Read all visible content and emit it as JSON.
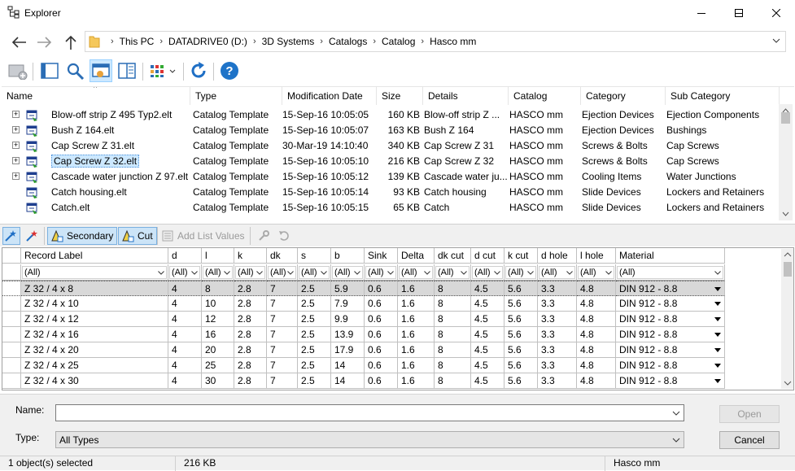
{
  "window": {
    "title": "Explorer",
    "controls": {
      "minimize": "minimize-icon",
      "maximize": "maximize-icon",
      "close": "close-icon"
    }
  },
  "address": {
    "crumbs": [
      "This PC",
      "DATADRIVE0 (D:)",
      "3D Systems",
      "Catalogs",
      "Catalog",
      "Hasco mm"
    ]
  },
  "filelist": {
    "columns": [
      "Name",
      "Type",
      "Modification Date",
      "Size",
      "Details",
      "Catalog",
      "Category",
      "Sub Category"
    ],
    "rows": [
      {
        "name": "Blow-off strip Z 495 Typ2.elt",
        "type": "Catalog Template",
        "date": "15-Sep-16 10:05:05",
        "size": "160 KB",
        "details": "Blow-off strip Z ...",
        "catalog": "HASCO mm",
        "category": "Ejection Devices",
        "sub": "Ejection Components",
        "expand": true
      },
      {
        "name": "Bush Z 164.elt",
        "type": "Catalog Template",
        "date": "15-Sep-16 10:05:07",
        "size": "163 KB",
        "details": "Bush Z 164",
        "catalog": "HASCO mm",
        "category": "Ejection Devices",
        "sub": "Bushings",
        "expand": true
      },
      {
        "name": "Cap Screw Z 31.elt",
        "type": "Catalog Template",
        "date": "30-Mar-19 14:10:40",
        "size": "340 KB",
        "details": "Cap Screw Z 31",
        "catalog": "HASCO mm",
        "category": "Screws & Bolts",
        "sub": "Cap Screws",
        "expand": true
      },
      {
        "name": "Cap Screw Z 32.elt",
        "type": "Catalog Template",
        "date": "15-Sep-16 10:05:10",
        "size": "216 KB",
        "details": "Cap Screw Z 32",
        "catalog": "HASCO mm",
        "category": "Screws & Bolts",
        "sub": "Cap Screws",
        "expand": true,
        "selected": true
      },
      {
        "name": "Cascade water junction Z 97.elt",
        "type": "Catalog Template",
        "date": "15-Sep-16 10:05:12",
        "size": "139 KB",
        "details": "Cascade water ju...",
        "catalog": "HASCO mm",
        "category": "Cooling Items",
        "sub": "Water Junctions",
        "expand": true
      },
      {
        "name": "Catch housing.elt",
        "type": "Catalog Template",
        "date": "15-Sep-16 10:05:14",
        "size": "93 KB",
        "details": "Catch housing",
        "catalog": "HASCO mm",
        "category": "Slide Devices",
        "sub": "Lockers and Retainers",
        "expand": false
      },
      {
        "name": "Catch.elt",
        "type": "Catalog Template",
        "date": "15-Sep-16 10:05:15",
        "size": "65 KB",
        "details": "Catch",
        "catalog": "HASCO mm",
        "category": "Slide Devices",
        "sub": "Lockers and Retainers",
        "expand": false
      }
    ]
  },
  "records_toolbar": {
    "secondary": "Secondary",
    "cut": "Cut",
    "add_list_values": "Add List Values"
  },
  "grid": {
    "columns": [
      "Record Label",
      "d",
      "l",
      "k",
      "dk",
      "s",
      "b",
      "Sink",
      "Delta",
      "dk cut",
      "d cut",
      "k cut",
      "d hole",
      "l hole",
      "Material"
    ],
    "filter_value": "(All)",
    "rows": [
      [
        "Z 32 / 4 x 8",
        "4",
        "8",
        "2.8",
        "7",
        "2.5",
        "5.9",
        "0.6",
        "1.6",
        "8",
        "4.5",
        "5.6",
        "3.3",
        "4.8",
        "DIN 912 - 8.8"
      ],
      [
        "Z 32 / 4 x 10",
        "4",
        "10",
        "2.8",
        "7",
        "2.5",
        "7.9",
        "0.6",
        "1.6",
        "8",
        "4.5",
        "5.6",
        "3.3",
        "4.8",
        "DIN 912 - 8.8"
      ],
      [
        "Z 32 / 4 x 12",
        "4",
        "12",
        "2.8",
        "7",
        "2.5",
        "9.9",
        "0.6",
        "1.6",
        "8",
        "4.5",
        "5.6",
        "3.3",
        "4.8",
        "DIN 912 - 8.8"
      ],
      [
        "Z 32 / 4 x 16",
        "4",
        "16",
        "2.8",
        "7",
        "2.5",
        "13.9",
        "0.6",
        "1.6",
        "8",
        "4.5",
        "5.6",
        "3.3",
        "4.8",
        "DIN 912 - 8.8"
      ],
      [
        "Z 32 / 4 x 20",
        "4",
        "20",
        "2.8",
        "7",
        "2.5",
        "17.9",
        "0.6",
        "1.6",
        "8",
        "4.5",
        "5.6",
        "3.3",
        "4.8",
        "DIN 912 - 8.8"
      ],
      [
        "Z 32 / 4 x 25",
        "4",
        "25",
        "2.8",
        "7",
        "2.5",
        "14",
        "0.6",
        "1.6",
        "8",
        "4.5",
        "5.6",
        "3.3",
        "4.8",
        "DIN 912 - 8.8"
      ],
      [
        "Z 32 / 4 x 30",
        "4",
        "30",
        "2.8",
        "7",
        "2.5",
        "14",
        "0.6",
        "1.6",
        "8",
        "4.5",
        "5.6",
        "3.3",
        "4.8",
        "DIN 912 - 8.8"
      ]
    ]
  },
  "form": {
    "name_label": "Name:",
    "name_value": "",
    "type_label": "Type:",
    "type_value": "All Types",
    "open_label": "Open",
    "cancel_label": "Cancel"
  },
  "status": {
    "selected": "1 object(s) selected",
    "size": "216 KB",
    "catalog": "Hasco mm"
  },
  "colors": {
    "selection": "#cce8ff",
    "accent": "#1f6fc5",
    "help": "#1e73c8"
  }
}
